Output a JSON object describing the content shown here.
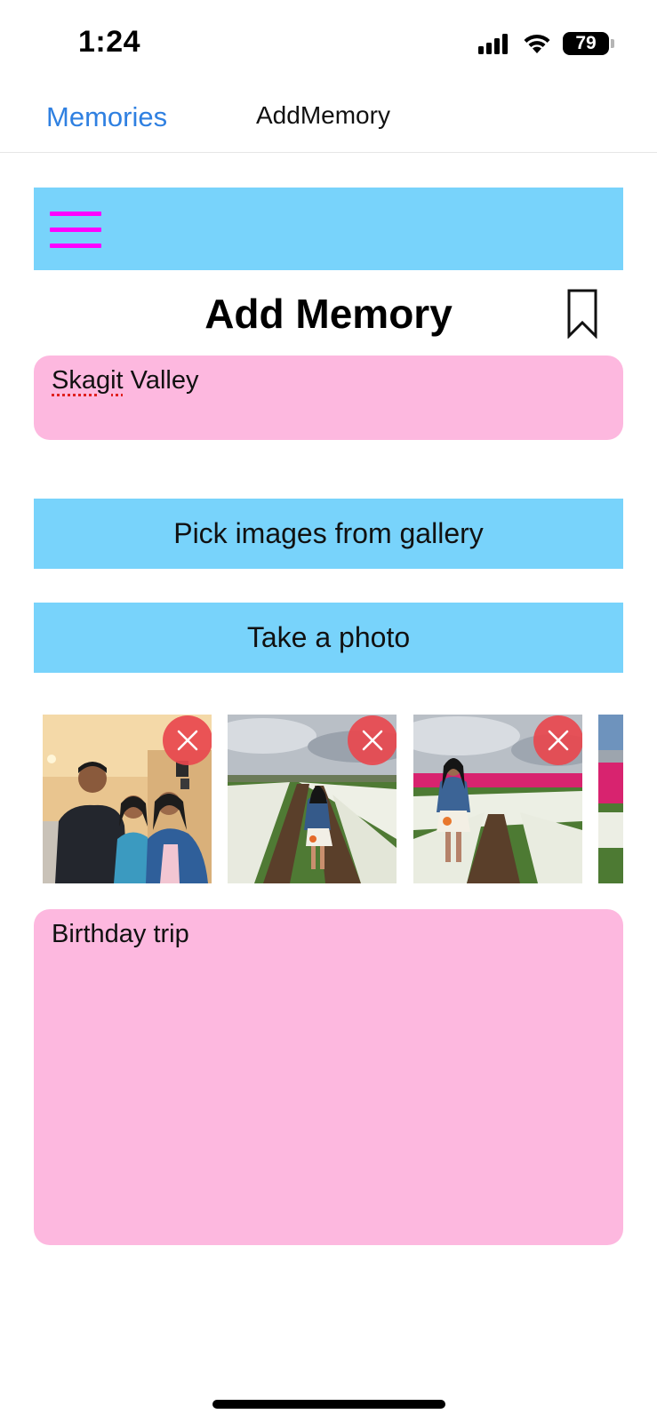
{
  "status_bar": {
    "time": "1:24",
    "battery_level": "79",
    "icons": [
      "cellular-signal-icon",
      "wifi-icon",
      "battery-icon"
    ]
  },
  "nav": {
    "back_label": "Memories",
    "title": "AddMemory"
  },
  "page": {
    "title": "Add Memory",
    "menu_icon": "hamburger-menu-icon",
    "bookmark_icon": "bookmark-icon"
  },
  "form": {
    "title_value": "Skagit Valley",
    "title_misspelled_word": "Skagit",
    "title_rest": " Valley",
    "pick_images_label": "Pick images from gallery",
    "take_photo_label": "Take a photo",
    "description_value": "Birthday trip"
  },
  "photos": [
    {
      "scene": "three people posing indoors",
      "remove_icon": "close-icon"
    },
    {
      "scene": "person in white tulip field, back view",
      "remove_icon": "close-icon"
    },
    {
      "scene": "person standing in tulip field",
      "remove_icon": "close-icon"
    },
    {
      "scene": "tulip field, partially visible",
      "remove_icon": ""
    }
  ],
  "colors": {
    "banner_blue": "#78d3fb",
    "field_pink": "#fdb8df",
    "menu_magenta": "#ff00ff",
    "link_blue": "#2f80e1",
    "remove_red": "#e8484e"
  }
}
